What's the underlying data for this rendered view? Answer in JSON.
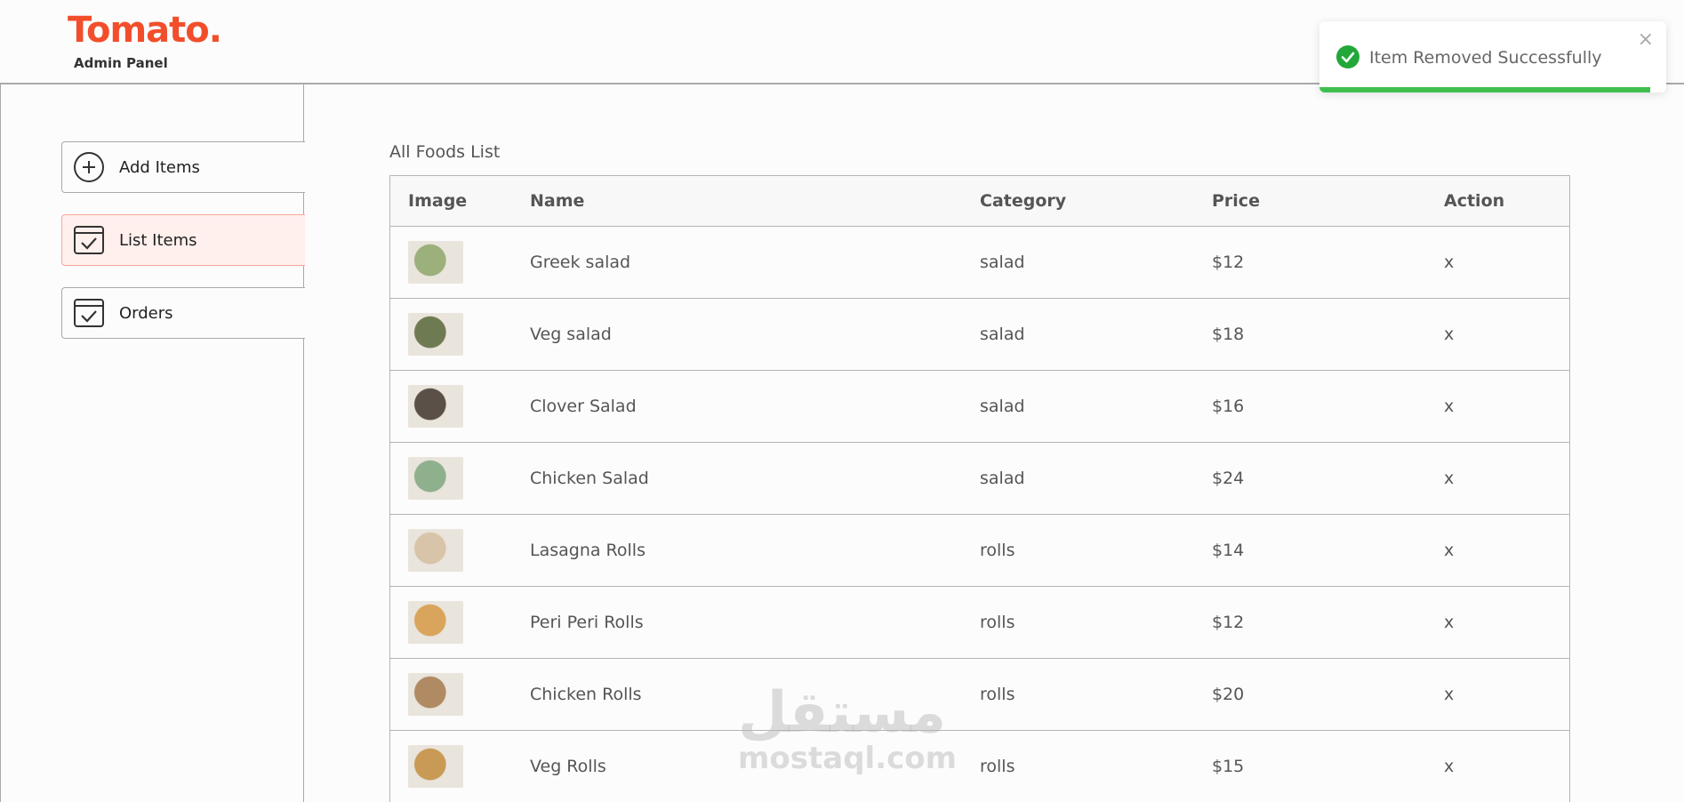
{
  "header": {
    "logo": "Tomato.",
    "subtitle": "Admin Panel"
  },
  "sidebar": {
    "items": [
      {
        "label": "Add Items",
        "icon": "plus-circle-icon",
        "active": false
      },
      {
        "label": "List Items",
        "icon": "calendar-check-icon",
        "active": true
      },
      {
        "label": "Orders",
        "icon": "calendar-check-icon",
        "active": false
      }
    ]
  },
  "main": {
    "title": "All Foods List",
    "columns": [
      "Image",
      "Name",
      "Category",
      "Price",
      "Action"
    ],
    "rows": [
      {
        "name": "Greek salad",
        "category": "salad",
        "price": "$12",
        "action": "x",
        "thumb": "#9bb07a"
      },
      {
        "name": "Veg salad",
        "category": "salad",
        "price": "$18",
        "action": "x",
        "thumb": "#6e7a52"
      },
      {
        "name": "Clover Salad",
        "category": "salad",
        "price": "$16",
        "action": "x",
        "thumb": "#5a5048"
      },
      {
        "name": "Chicken Salad",
        "category": "salad",
        "price": "$24",
        "action": "x",
        "thumb": "#8fb08c"
      },
      {
        "name": "Lasagna Rolls",
        "category": "rolls",
        "price": "$14",
        "action": "x",
        "thumb": "#d8c4a8"
      },
      {
        "name": "Peri Peri Rolls",
        "category": "rolls",
        "price": "$12",
        "action": "x",
        "thumb": "#d9a55c"
      },
      {
        "name": "Chicken Rolls",
        "category": "rolls",
        "price": "$20",
        "action": "x",
        "thumb": "#b08a62"
      },
      {
        "name": "Veg Rolls",
        "category": "rolls",
        "price": "$15",
        "action": "x",
        "thumb": "#c99a55"
      }
    ]
  },
  "toast": {
    "message": "Item Removed Successfully",
    "close": "×",
    "progress": 0.955,
    "color": "#3fbf4e"
  },
  "watermark": {
    "arabic": "مستقل",
    "site": "mostaql.com"
  },
  "colors": {
    "brand": "#f24e2b",
    "active_bg": "#fff0ed",
    "active_border": "#f5a995"
  }
}
